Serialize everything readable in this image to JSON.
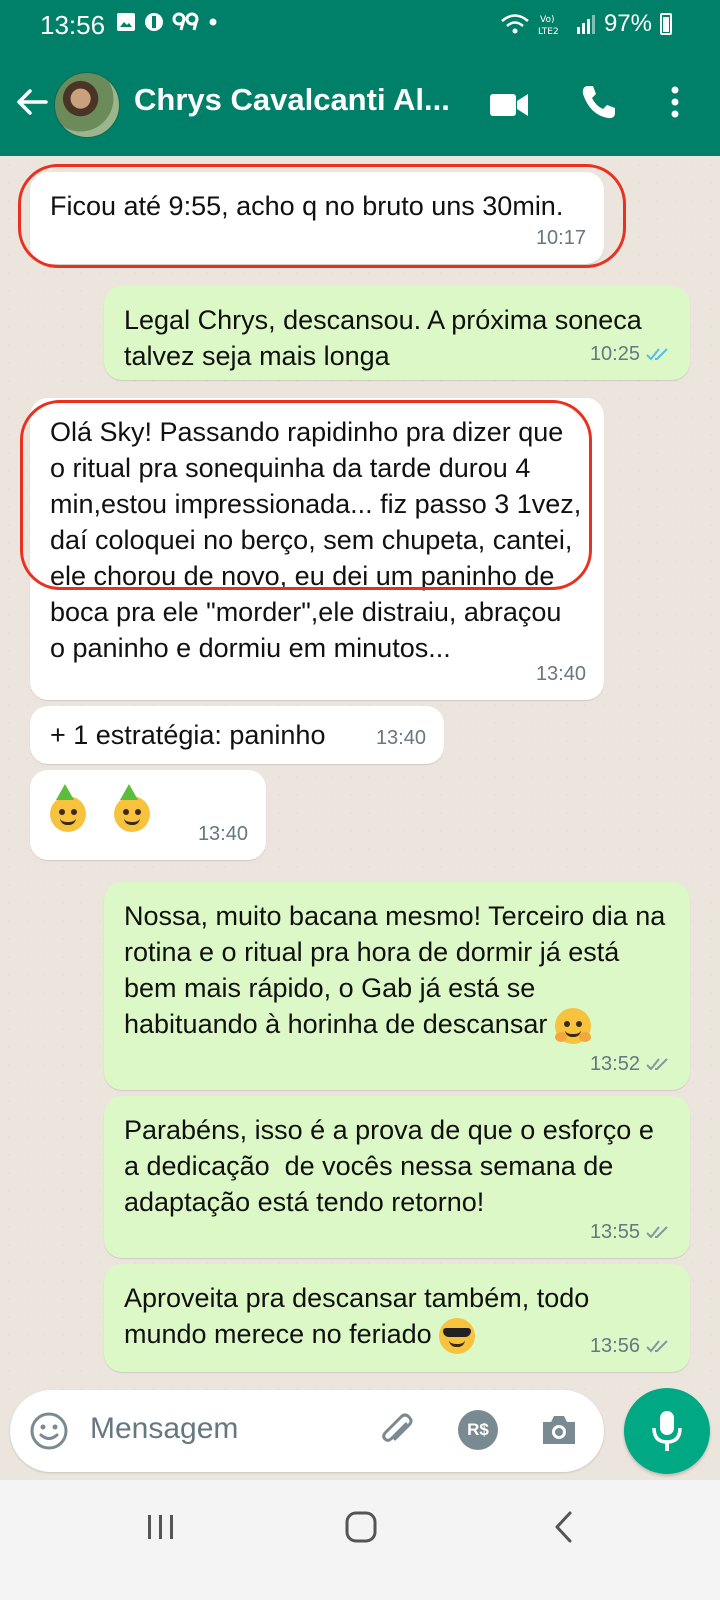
{
  "status_bar": {
    "time": "13:56",
    "battery": "97%",
    "network_label": "Vo) LTE2"
  },
  "header": {
    "contact_name": "Chrys Cavalcanti Al...",
    "icons": [
      "back-arrow-icon",
      "video-call-icon",
      "phone-icon",
      "more-vert-icon"
    ]
  },
  "messages": [
    {
      "direction": "in",
      "text": "Ficou até 9:55, acho q no bruto uns 30min.",
      "time": "10:17",
      "highlighted": true
    },
    {
      "direction": "out",
      "text": "Legal Chrys, descansou. A próxima soneca talvez seja mais longa",
      "time": "10:25",
      "status": "read"
    },
    {
      "direction": "in",
      "text": "Olá Sky! Passando rapidinho pra dizer que o ritual pra sonequinha da tarde durou 4 min,estou impressionada... fiz passo 3 1vez, daí coloquei no berço, sem chupeta, cantei, ele chorou de novo, eu dei um paninho de boca pra ele \"morder\",ele distraiu, abraçou o paninho e dormiu em minutos...",
      "time": "13:40",
      "highlighted": true
    },
    {
      "direction": "in",
      "text": "+ 1 estratégia: paninho",
      "time": "13:40"
    },
    {
      "direction": "in",
      "text": "",
      "emoji": [
        "partying-face",
        "partying-face"
      ],
      "time": "13:40"
    },
    {
      "direction": "out",
      "text": "Nossa, muito bacana mesmo! Terceiro dia na rotina e o ritual pra hora de dormir já está bem mais rápido, o Gab já está se habituando à horinha de descansar",
      "emoji": [
        "hugging-face"
      ],
      "time": "13:52",
      "status": "delivered"
    },
    {
      "direction": "out",
      "text": "Parabéns, isso é a prova de que o esforço e a dedicação  de vocês nessa semana de adaptação está tendo retorno!",
      "time": "13:55",
      "status": "delivered"
    },
    {
      "direction": "out",
      "text": "Aproveita pra descansar também, todo mundo merece no feriado",
      "emoji": [
        "sunglasses-face"
      ],
      "time": "13:56",
      "status": "delivered"
    }
  ],
  "input": {
    "placeholder": "Mensagem",
    "pay_label": "R$"
  },
  "colors": {
    "header": "#008069",
    "outgoing_bubble": "#dcf8c6",
    "incoming_bubble": "#ffffff",
    "read_ticks": "#53bdeb",
    "highlight_outline": "#e8321f",
    "mic_button": "#00a884"
  }
}
